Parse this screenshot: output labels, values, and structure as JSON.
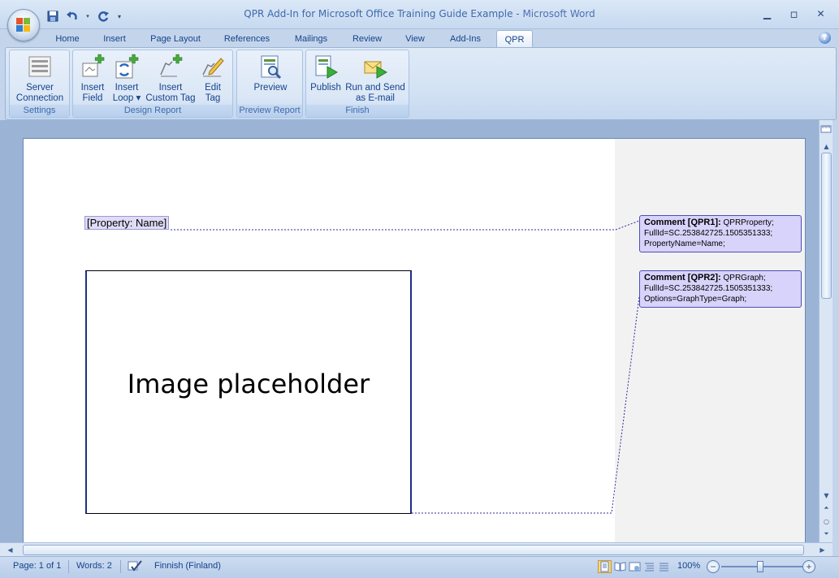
{
  "window": {
    "title_doc": "QPR Add-In for Microsoft Office Training Guide Example",
    "title_sep": " - ",
    "title_app": "Microsoft Word",
    "minimize_glyph": "▁",
    "maximize_glyph": "▫",
    "close_glyph": "✕"
  },
  "tabs": [
    {
      "label": "Home"
    },
    {
      "label": "Insert"
    },
    {
      "label": "Page Layout"
    },
    {
      "label": "References"
    },
    {
      "label": "Mailings"
    },
    {
      "label": "Review"
    },
    {
      "label": "View"
    },
    {
      "label": "Add-Ins"
    },
    {
      "label": "QPR"
    }
  ],
  "active_tab": "QPR",
  "ribbon": {
    "groups": [
      {
        "label": "Settings",
        "buttons": [
          {
            "line1": "Server",
            "line2": "Connection",
            "icon": "server-connection-icon"
          }
        ]
      },
      {
        "label": "Design Report",
        "buttons": [
          {
            "line1": "Insert",
            "line2": "Field",
            "icon": "insert-field-icon"
          },
          {
            "line1": "Insert",
            "line2": "Loop ▾",
            "icon": "insert-loop-icon"
          },
          {
            "line1": "Insert",
            "line2": "Custom Tag",
            "icon": "insert-custom-tag-icon"
          },
          {
            "line1": "Edit",
            "line2": "Tag",
            "icon": "edit-tag-icon"
          }
        ]
      },
      {
        "label": "Preview Report",
        "buttons": [
          {
            "line1": "Preview",
            "line2": "",
            "icon": "preview-icon"
          }
        ]
      },
      {
        "label": "Finish",
        "buttons": [
          {
            "line1": "Publish",
            "line2": "",
            "icon": "publish-icon"
          },
          {
            "line1": "Run and Send",
            "line2": "as E-mail",
            "icon": "email-icon"
          }
        ]
      }
    ]
  },
  "document": {
    "field_text": "[Property: Name]",
    "image_placeholder": "Image placeholder"
  },
  "comments": [
    {
      "title": "Comment [QPR1]:",
      "line1": " QPRProperty;",
      "line2": "FullId=SC.253842725.1505351333;",
      "line3": "PropertyName=Name;"
    },
    {
      "title": "Comment [QPR2]:",
      "line1": " QPRGraph;",
      "line2": "FullId=SC.253842725.1505351333;",
      "line3": "Options=GraphType=Graph;"
    }
  ],
  "status": {
    "page": "Page: 1 of 1",
    "words": "Words: 2",
    "language": "Finnish (Finland)",
    "zoom": "100%"
  },
  "colors": {
    "accent": "#15428b",
    "comment_fill": "#d7d3fa",
    "field_fill": "#e0dcf5"
  }
}
